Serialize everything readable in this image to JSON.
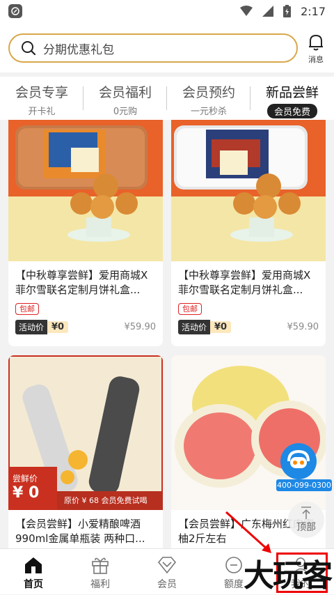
{
  "status": {
    "time": "2:17"
  },
  "search": {
    "placeholder": "分期优惠礼包",
    "message_label": "消息"
  },
  "tabs": [
    {
      "title": "会员专享",
      "sub": "开卡礼"
    },
    {
      "title": "会员福利",
      "sub": "0元购"
    },
    {
      "title": "会员预约",
      "sub": "一元秒杀"
    },
    {
      "title": "新品尝鲜",
      "sub": "会员免费"
    }
  ],
  "products": [
    {
      "title": "【中秋尊享尝鲜】爱用商城X菲尔雪联名定制月饼礼盒...",
      "badge": "包邮",
      "activity_label": "活动价",
      "activity_price": "¥0",
      "original_price": "¥59.90"
    },
    {
      "title": "【中秋尊享尝鲜】爱用商城X菲尔雪联名定制月饼礼盒...",
      "badge": "包邮",
      "activity_label": "活动价",
      "activity_price": "¥0",
      "original_price": "¥59.90"
    },
    {
      "title": "【会员尝鲜】小爱精酿啤酒990ml金属单瓶装 两种口...",
      "tag_label": "尝鲜价",
      "tag_price": "¥ 0",
      "promo": "原价 ¥ 68 会员免费试喝"
    },
    {
      "title": "【会员尝鲜】广东梅州红肉蜜柚2斤左右"
    }
  ],
  "support": {
    "phone": "400-099-0300"
  },
  "top_button": {
    "label": "顶部"
  },
  "bottom_nav": [
    {
      "label": "首页",
      "icon": "home-icon"
    },
    {
      "label": "福利",
      "icon": "gift-icon"
    },
    {
      "label": "会员",
      "icon": "diamond-icon"
    },
    {
      "label": "额度",
      "icon": "credit-icon"
    },
    {
      "label": "我的",
      "icon": "user-icon"
    }
  ],
  "watermark": "大玩客",
  "colors": {
    "accent": "#d9a74a",
    "badge_red": "#dd2222",
    "support_blue": "#1e88e5"
  }
}
